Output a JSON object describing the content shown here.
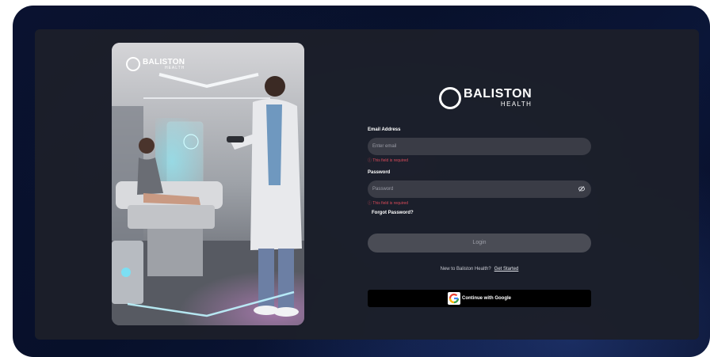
{
  "photo_logo": {
    "name": "BALISTON",
    "sub": "HEALTH"
  },
  "brand": {
    "name": "BALISTON",
    "sub": "HEALTH"
  },
  "form": {
    "email_label": "Email Address",
    "email_placeholder": "Enter email",
    "email_error": "ⓘ This field is required",
    "password_label": "Password",
    "password_placeholder": "Password",
    "password_error": "ⓘ This field is required",
    "forgot": "Forgot Password?",
    "login_label": "Login",
    "signup_prompt": "New to Baliston Health?",
    "signup_link": "Get Started",
    "google_label": "Continue with Google"
  },
  "icons": {
    "password_toggle": "eye-off-icon",
    "google": "google-icon"
  },
  "colors": {
    "panel": "#1c1f2a",
    "error": "#d94b5a",
    "input": "#3a3c46",
    "login": "#4a4c55"
  }
}
